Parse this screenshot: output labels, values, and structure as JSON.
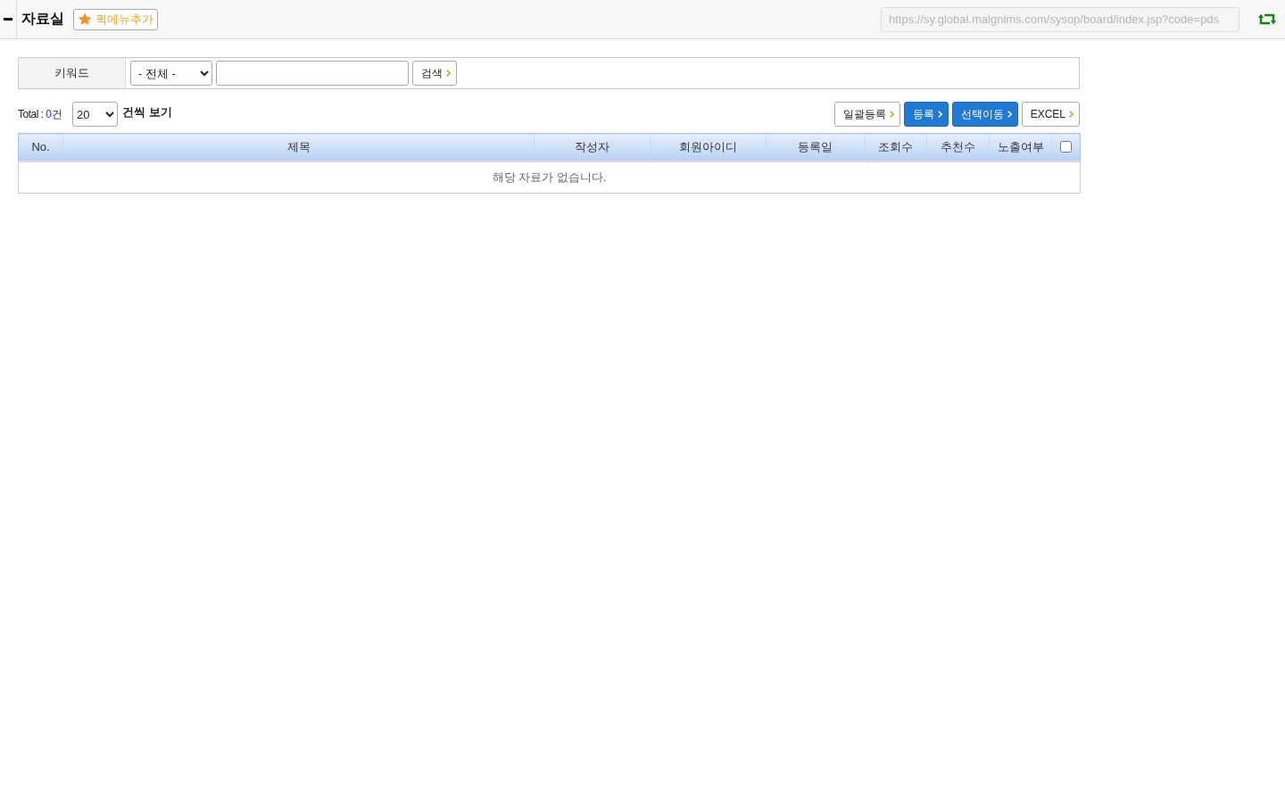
{
  "header": {
    "title": "자료실",
    "quick_menu_button": "퀵메뉴추가",
    "url_field": {
      "value": "https://sy.global.malgnlms.com/sysop/board/index.jsp?code=pds"
    }
  },
  "search": {
    "label": "키워드",
    "scope_select": "- 전체 -",
    "search_button": "검색"
  },
  "list_bar": {
    "total_label": "Total : ",
    "total_count": "0",
    "count_unit": "건",
    "page_size": "20",
    "page_size_suffix": "건씩 보기",
    "buttons": [
      {
        "label": "일괄등록",
        "kind": "default"
      },
      {
        "label": "등록",
        "kind": "primary"
      },
      {
        "label": "선택이동",
        "kind": "primary"
      },
      {
        "label": "EXCEL",
        "kind": "default"
      }
    ]
  },
  "table": {
    "columns": [
      "No.",
      "제목",
      "작성자",
      "회원아이디",
      "등록일",
      "조회수",
      "추천수",
      "노출여부"
    ],
    "select_all": {
      "checked": false
    },
    "empty_message": "해당 자료가 없습니다."
  }
}
